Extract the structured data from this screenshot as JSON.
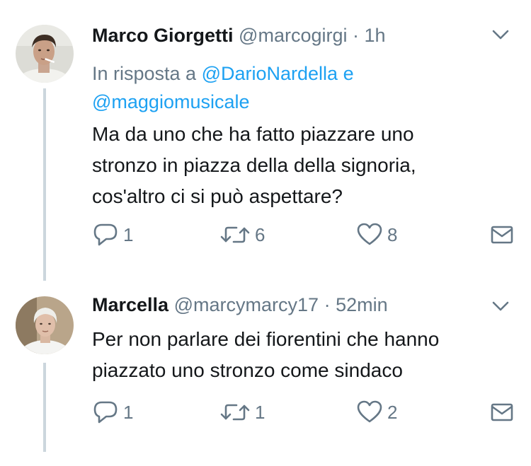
{
  "tweets": [
    {
      "name": "Marco Giorgetti",
      "handle": "@marcogirgi",
      "separator": "·",
      "time": "1h",
      "reply_prefix": "In risposta a",
      "reply_mention_1": "@DarioNardella",
      "reply_conjunction": "e",
      "reply_mention_2": "@maggiomusicale",
      "text_lines": [
        "Ma da uno che ha fatto piazzare uno",
        "stronzo in piazza della della signoria,",
        "cos'altro ci si può aspettare?"
      ],
      "reply_count": "1",
      "retweet_count": "6",
      "like_count": "8"
    },
    {
      "name": "Marcella",
      "handle": "@marcymarcy17",
      "separator": "·",
      "time": "52min",
      "text_lines": [
        "Per non parlare dei fiorentini che hanno",
        "piazzato uno stronzo come sindaco"
      ],
      "reply_count": "1",
      "retweet_count": "1",
      "like_count": "2"
    }
  ],
  "icons": {
    "reply": "reply-icon",
    "retweet": "retweet-icon",
    "like": "heart-icon",
    "dm": "envelope-icon",
    "menu": "chevron-down-icon"
  },
  "colors": {
    "text": "#14171a",
    "secondary": "#657786",
    "link": "#1da1f2",
    "thread_line": "#ccd6dd"
  }
}
